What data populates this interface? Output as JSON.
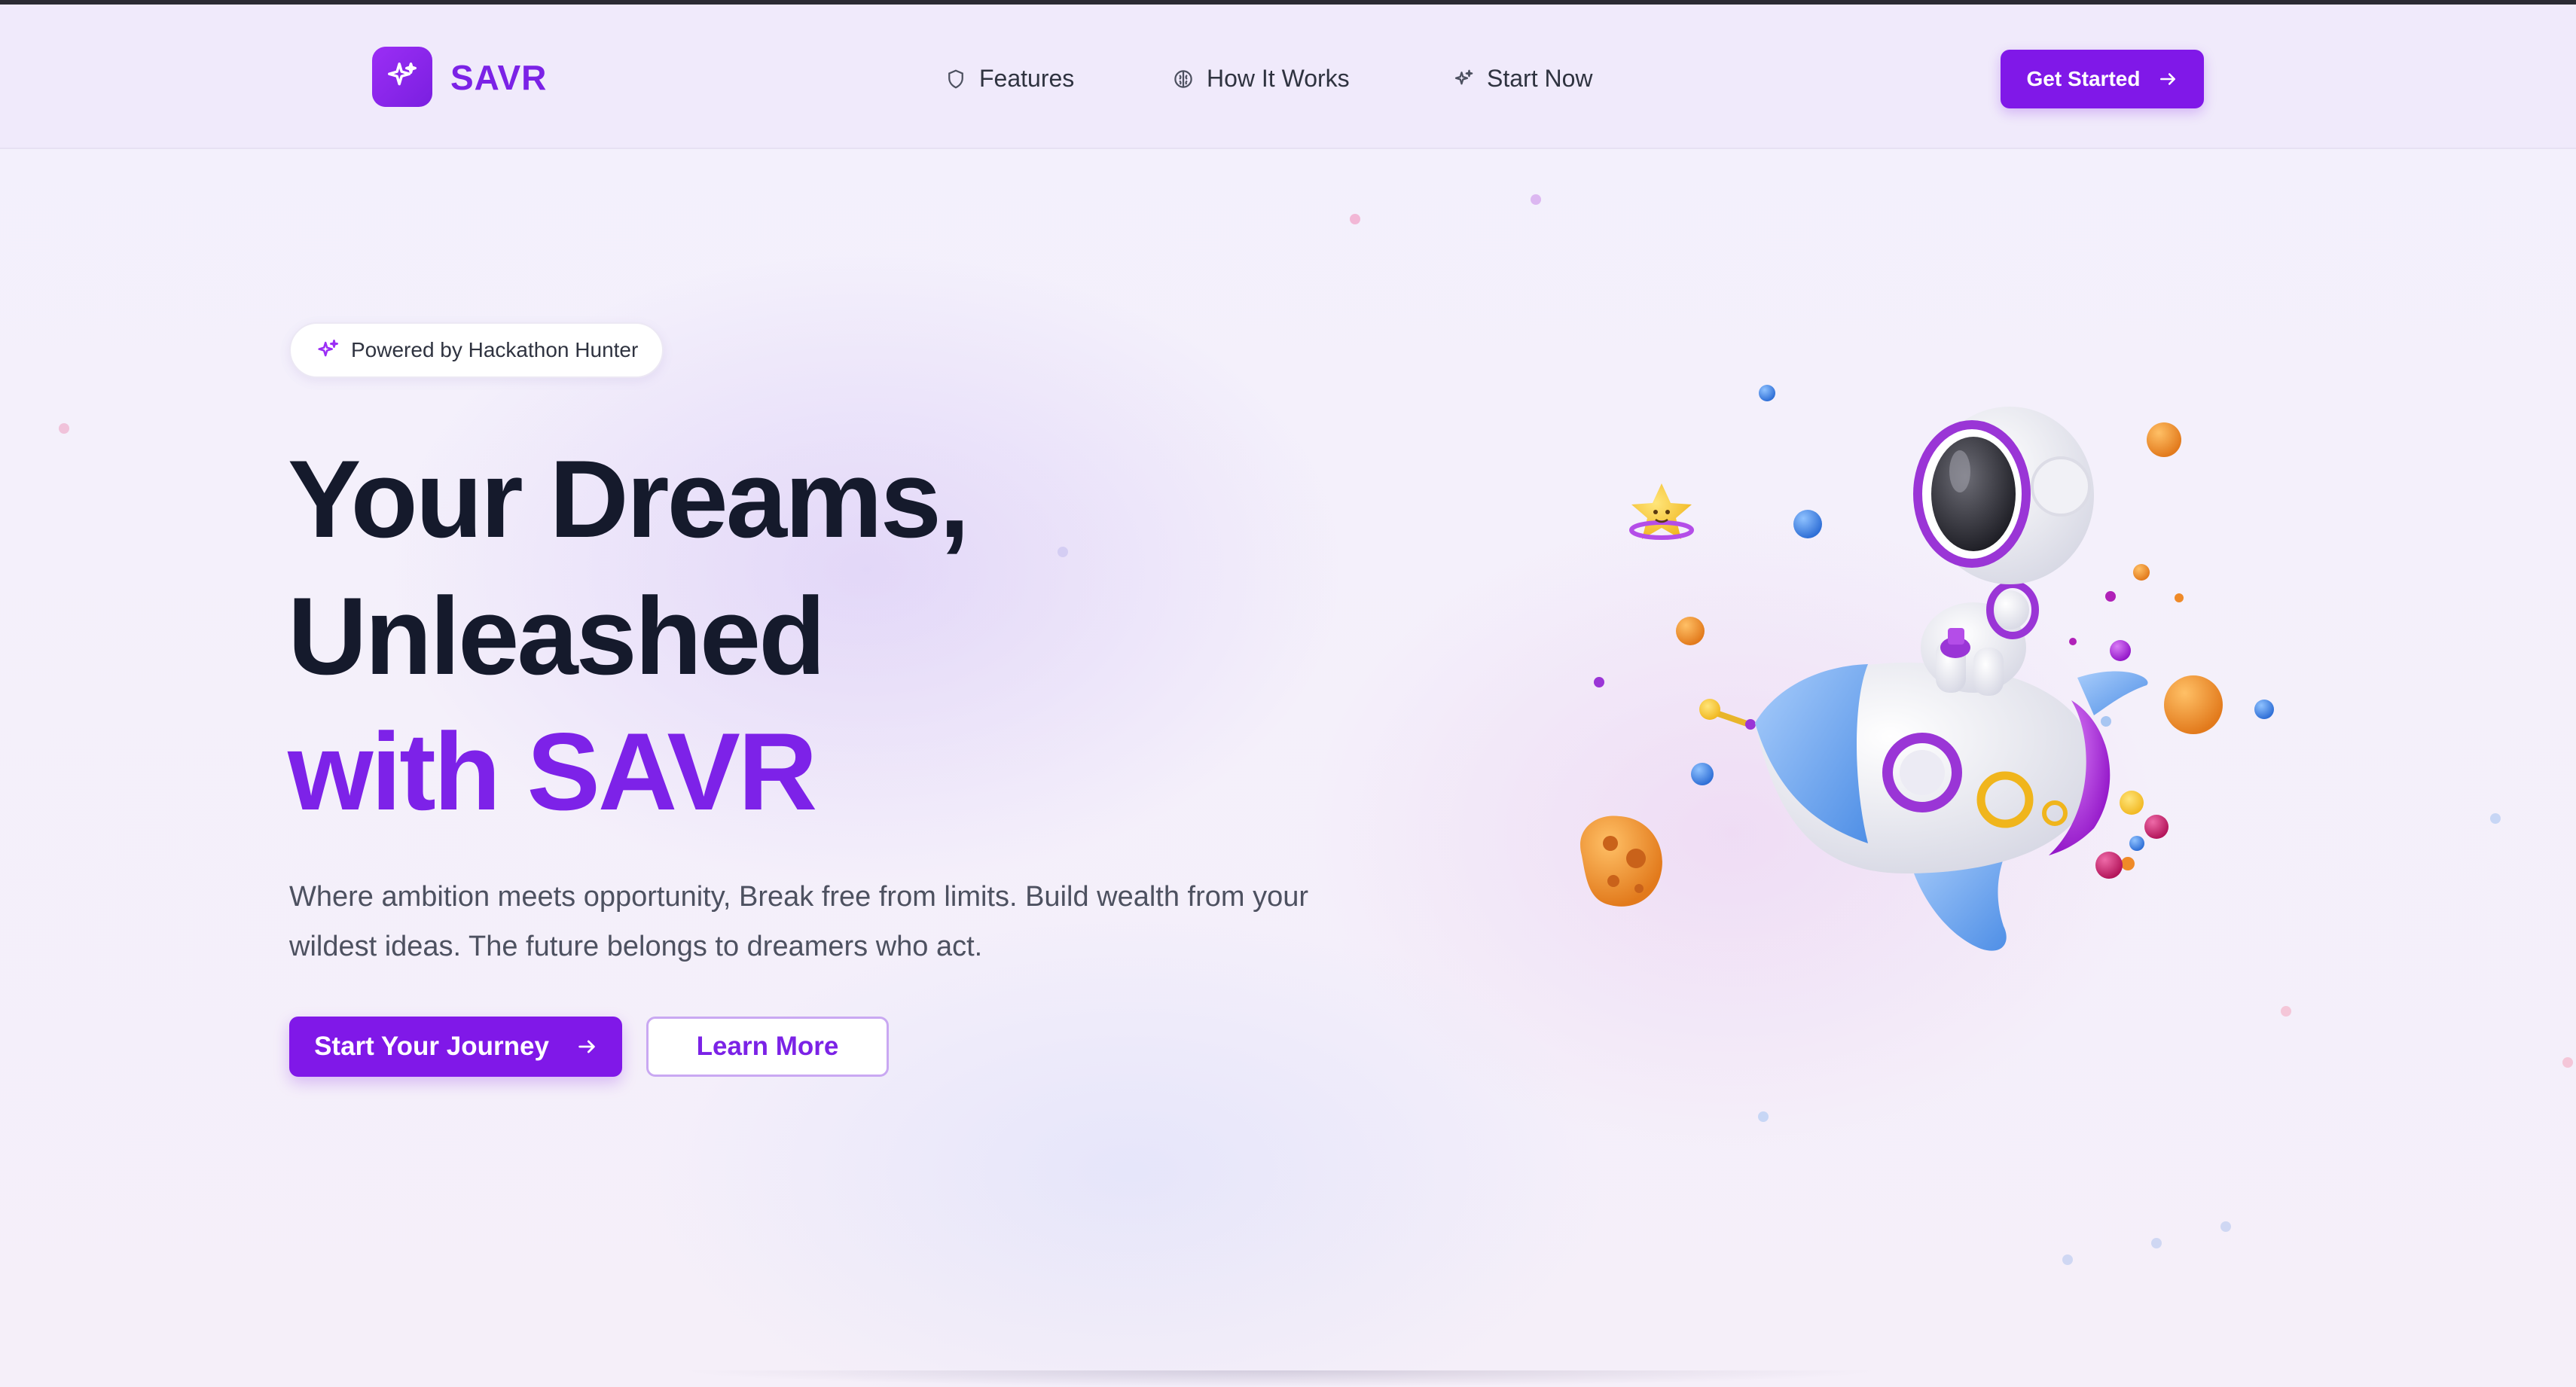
{
  "brand": {
    "name": "SAVR",
    "accent": "#7b22e6",
    "primary_button": "#8018e8"
  },
  "nav": {
    "items": [
      {
        "label": "Features",
        "icon": "shield-icon"
      },
      {
        "label": "How It Works",
        "icon": "brain-icon"
      },
      {
        "label": "Start Now",
        "icon": "sparkles-icon"
      }
    ],
    "cta_label": "Get Started"
  },
  "hero": {
    "badge": "Powered by Hackathon Hunter",
    "title_line1": "Your Dreams,",
    "title_line2": "Unleashed",
    "title_line3": "with SAVR",
    "subtitle": "Where ambition meets opportunity, Break free from limits. Build wealth from your wildest ideas. The future belongs to dreamers who act.",
    "primary_button": "Start Your Journey",
    "secondary_button": "Learn More"
  },
  "illustration": {
    "name": "astronaut-riding-rocket"
  }
}
